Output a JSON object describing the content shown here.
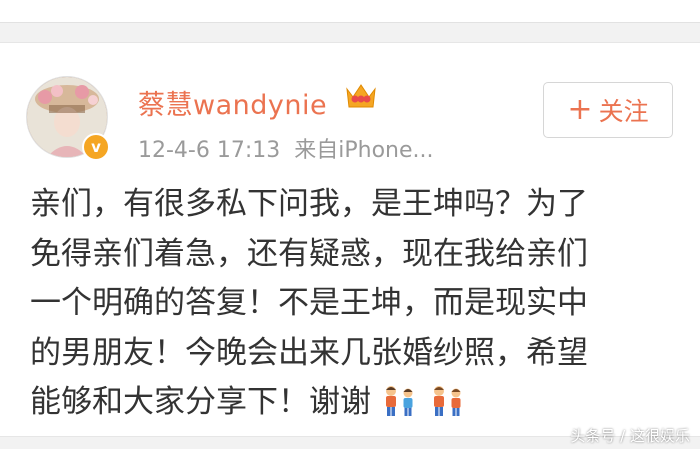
{
  "post": {
    "username": "蔡慧wandynie",
    "timestamp": "12-4-6 17:13",
    "source": "来自iPhone...",
    "follow_label": "关注",
    "follow_icon": "plus-icon",
    "verified_badge": "v",
    "content_lines": [
      "亲们，有很多私下问我，是王坤吗？为了",
      "免得亲们着急，还有疑惑，现在我给亲们",
      "一个明确的答复！不是王坤，而是现实中",
      "的男朋友！今晚会出来几张婚纱照，希望",
      "能够和大家分享下！谢谢"
    ],
    "content_emoji": "family-emoji"
  },
  "watermark": "头条号 / 这很娱乐",
  "colors": {
    "accent": "#eb7350",
    "meta": "#9a9a9a",
    "text": "#333333",
    "badge": "#f5a623"
  }
}
